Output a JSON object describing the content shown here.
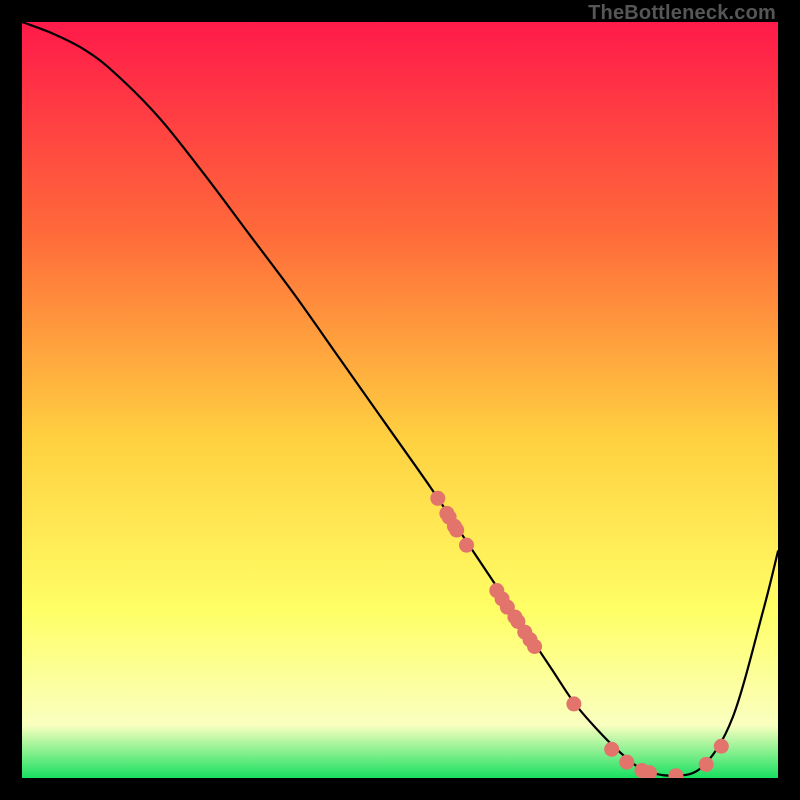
{
  "watermark": "TheBottleneck.com",
  "chart_data": {
    "type": "line",
    "title": "",
    "xlabel": "",
    "ylabel": "",
    "xlim": [
      0,
      100
    ],
    "ylim": [
      0,
      100
    ],
    "grid": false,
    "legend": false,
    "series": [
      {
        "name": "bottleneck-curve",
        "type": "line",
        "x": [
          0,
          4,
          8,
          12,
          18,
          24,
          30,
          36,
          42,
          48,
          54,
          58,
          62,
          66,
          70,
          73,
          76,
          79,
          82,
          86,
          90,
          94,
          98,
          100
        ],
        "y": [
          100,
          98.5,
          96.5,
          93.5,
          87.5,
          80,
          72,
          64,
          55.5,
          47,
          38.5,
          32.5,
          26.5,
          20.5,
          14.5,
          10,
          6.5,
          3.5,
          1.2,
          0.3,
          1.5,
          8,
          22,
          30
        ]
      },
      {
        "name": "sample-markers",
        "type": "scatter",
        "x": [
          55.0,
          56.2,
          56.5,
          57.2,
          57.5,
          58.8,
          62.8,
          63.5,
          64.2,
          65.2,
          65.6,
          66.5,
          67.2,
          67.8,
          73.0,
          78.0,
          80.0,
          82.0,
          83.0,
          86.5,
          90.5,
          92.5
        ],
        "y": [
          37.0,
          35.0,
          34.5,
          33.3,
          32.8,
          30.8,
          24.8,
          23.7,
          22.6,
          21.3,
          20.7,
          19.3,
          18.3,
          17.4,
          9.8,
          3.8,
          2.1,
          1.0,
          0.7,
          0.3,
          1.8,
          4.2
        ]
      }
    ],
    "gradient_bg": {
      "top": "#ff1a4a",
      "mid1": "#ff6a3a",
      "mid2": "#ffd040",
      "mid3": "#ffff66",
      "mid4": "#faffc0",
      "bottom": "#18e060"
    },
    "marker_color": "#e2746c",
    "curve_color": "#000000"
  }
}
